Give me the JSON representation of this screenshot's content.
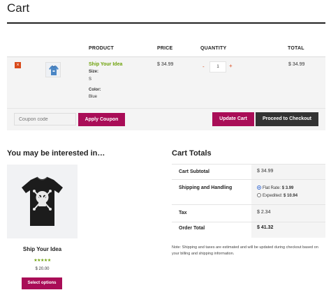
{
  "page": {
    "title": "Cart"
  },
  "cart_table": {
    "headers": [
      "PRODUCT",
      "PRICE",
      "QUANTITY",
      "TOTAL"
    ],
    "items": [
      {
        "remove_label": "×",
        "name": "Ship Your Idea",
        "size_label": "Size:",
        "size_value": "S",
        "color_label": "Color:",
        "color_value": "Blue",
        "price": "$ 34.99",
        "qty_minus": "-",
        "quantity": "1",
        "qty_plus": "+",
        "total": "$ 34.99",
        "thumbnail_icon": "hoodie-thumbnail-icon"
      }
    ]
  },
  "actions": {
    "coupon_placeholder": "Coupon code",
    "apply_coupon_label": "Apply Coupon",
    "update_cart_label": "Update Cart",
    "checkout_label": "Proceed to Checkout"
  },
  "cross_sells": {
    "title": "You may be interested in…",
    "products": [
      {
        "name": "Ship Your Idea",
        "rating": 4,
        "stars_text": "★★★★★",
        "price": "$ 20.00",
        "button_label": "Select options",
        "image_icon": "skull-tshirt-icon"
      }
    ]
  },
  "cart_totals": {
    "title": "Cart Totals",
    "subtotal_label": "Cart Subtotal",
    "subtotal_value": "$ 34.99",
    "shipping_label": "Shipping and Handling",
    "shipping_options": [
      {
        "prefix": "Flat Rate: ",
        "amount": "$ 3.99",
        "selected": true
      },
      {
        "prefix": "Expedited: ",
        "amount": "$ 10.94",
        "selected": false
      }
    ],
    "tax_label": "Tax",
    "tax_value": "$ 2.34",
    "order_total_label": "Order Total",
    "order_total_value": "$ 41.32",
    "note": "Note: Shipping and taxes are estimated and will be updated during checkout based on your billing and shipping information."
  },
  "colors": {
    "accent": "#a90d57",
    "link_green": "#6ea20b",
    "remove_orange": "#d84a1b",
    "dark_button": "#333333"
  }
}
